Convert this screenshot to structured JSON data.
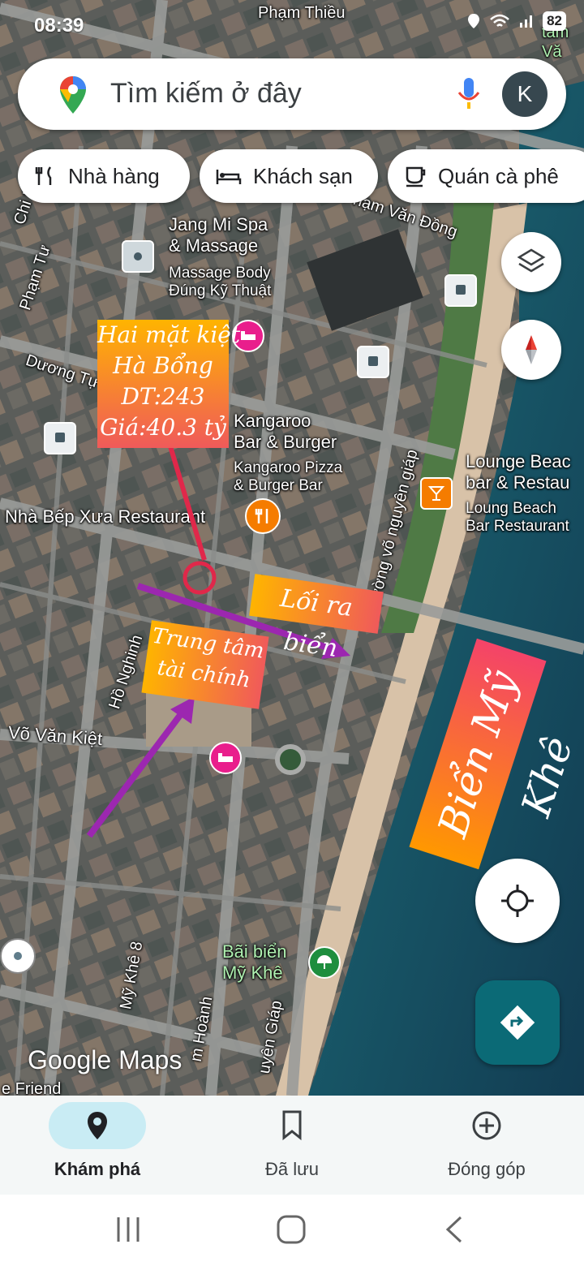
{
  "status_bar": {
    "time": "08:39",
    "battery": "82"
  },
  "search": {
    "placeholder": "Tìm kiếm ở đây",
    "avatar_letter": "K"
  },
  "chips": [
    {
      "label": "Nhà hàng",
      "icon": "restaurant-icon"
    },
    {
      "label": "Khách sạn",
      "icon": "hotel-icon"
    },
    {
      "label": "Quán cà phê",
      "icon": "coffee-icon"
    }
  ],
  "streets": {
    "pham_thieu": "Phạm Thiều",
    "pham_van_dong": "Phạm Văn Đồng",
    "pham_tu": "Phạm Tư",
    "duong_tu": "Dương Tự",
    "chi_lang": "Chi Lăng",
    "ho_nghinh": "Hồ Nghinh",
    "vo_van_kiet": "Võ Văn Kiệt",
    "vo_nguyen_giap": "đường võ nguyên giáp",
    "vo_nguyen_giap_south": "uyên Giáp",
    "my_khe_8": "Mỹ Khê 8",
    "hoanh": "m Hoành",
    "edge_right": "tâm\nVă",
    "friend": "e Friend"
  },
  "places": {
    "jang_mi": {
      "name": "Jang Mi Spa\n& Massage",
      "sub": "Massage Body\nĐúng Kỹ Thuật"
    },
    "kangaroo": {
      "name": "Kangaroo\nBar & Burger",
      "sub": "Kangaroo Pizza\n& Burger Bar"
    },
    "nha_bep_xua": {
      "name": "Nhà Bếp Xưa Restaurant"
    },
    "lounge": {
      "name": "Lounge Beac\nbar & Restau",
      "sub": "Loung Beach\nBar Restaurant"
    },
    "bai_bien": {
      "name": "Bãi biển\nMỹ Khê"
    }
  },
  "annotations": {
    "property": "Hai mặt kiệt\nHà Bổng\nDT:243\nGiá:40.3 tỷ",
    "beach_exit": "Lối ra biển",
    "finance_center": "Trung tâm\ntài chính",
    "beach_name": "Biển Mỹ Khê"
  },
  "watermark": "Google Maps",
  "bottom_nav": [
    {
      "label": "Khám phá",
      "icon": "explore-pin-icon",
      "active": true
    },
    {
      "label": "Đã lưu",
      "icon": "bookmark-icon",
      "active": false
    },
    {
      "label": "Đóng góp",
      "icon": "add-circle-icon",
      "active": false
    }
  ],
  "colors": {
    "accent": "#1a73e8",
    "directions_fab": "#0b6a76",
    "nav_pill": "#c9ecf4",
    "hotel_pin": "#e91e8c",
    "food_pin": "#f57c00"
  }
}
